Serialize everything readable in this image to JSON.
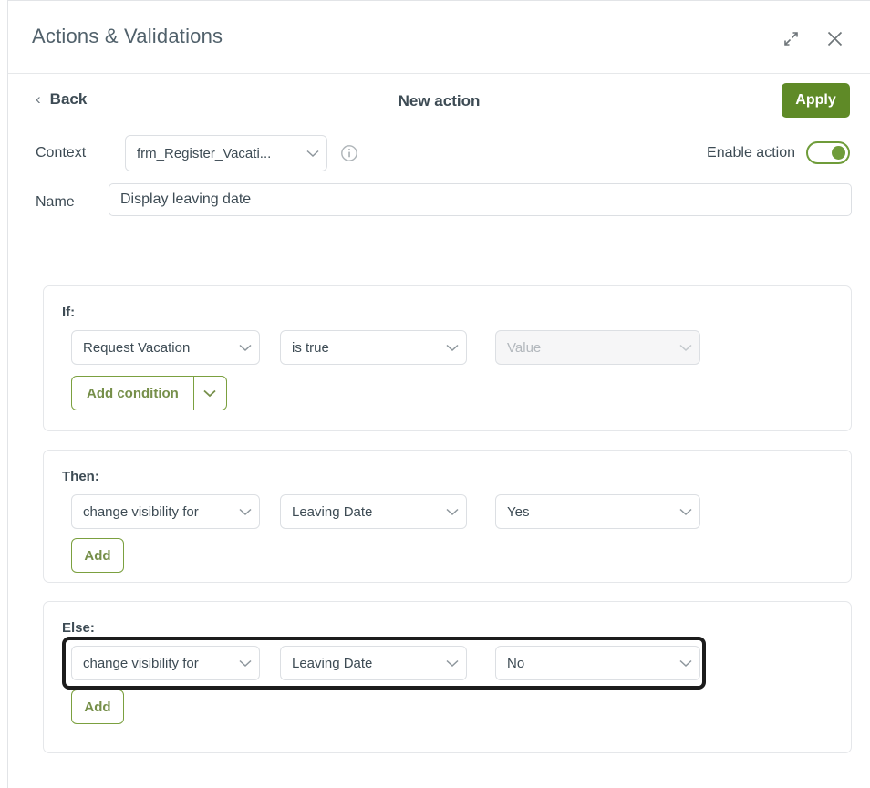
{
  "window": {
    "title": "Actions & Validations",
    "expand_icon": "expand-arrows-icon",
    "close_icon": "close-x-icon"
  },
  "nav": {
    "back_chevron": "‹",
    "back_label": "Back",
    "subtitle": "New action",
    "apply_label": "Apply"
  },
  "context": {
    "label": "Context",
    "value": "frm_Register_Vacati...",
    "info_icon": "info-circle-icon",
    "enable_label": "Enable action",
    "enable_on": "true"
  },
  "name": {
    "label": "Name",
    "value": "Display leaving date",
    "placeholder": "Name"
  },
  "sections": {
    "if": {
      "label": "If:",
      "condition": {
        "field": "Request Vacation",
        "operator": "is true",
        "value_placeholder": "Value",
        "value_disabled": "true"
      },
      "add_condition_label": "Add condition"
    },
    "then": {
      "label": "Then:",
      "action": {
        "operation": "change visibility for",
        "target": "Leaving Date",
        "value": "Yes"
      },
      "add_label": "Add"
    },
    "else": {
      "label": "Else:",
      "action": {
        "operation": "change visibility for",
        "target": "Leaving Date",
        "value": "No"
      },
      "add_label": "Add",
      "selected": "true"
    }
  },
  "colors": {
    "accent_green": "#5f8a27",
    "outline_green": "#7ba03f",
    "text_dark": "#3d4b54",
    "border_grey": "#dcdfe3",
    "selection_black": "#1c1c1c"
  }
}
